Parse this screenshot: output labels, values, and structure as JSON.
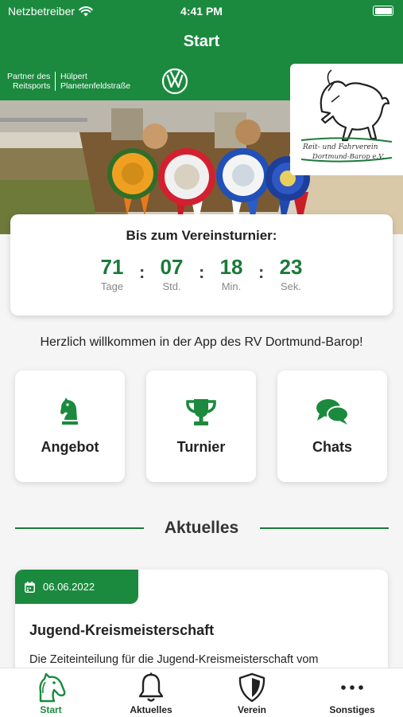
{
  "status_bar": {
    "carrier": "Netzbetreiber",
    "time": "4:41 PM"
  },
  "navbar": {
    "title": "Start"
  },
  "sponsor": {
    "partner_line1": "Partner des",
    "partner_line2": "Reitsports",
    "dealer_line1": "Hülpert",
    "dealer_line2": "Planetenfeldstraße"
  },
  "club_logo": {
    "name_line1": "Reit- und Fahrverein",
    "name_line2": "Dortmund-Barop e.V."
  },
  "countdown": {
    "heading": "Bis zum Vereinsturnier:",
    "units": [
      {
        "value": "71",
        "label": "Tage"
      },
      {
        "value": "07",
        "label": "Std."
      },
      {
        "value": "18",
        "label": "Min."
      },
      {
        "value": "23",
        "label": "Sek."
      }
    ],
    "separator": ":"
  },
  "welcome": "Herzlich willkommen in der App des RV Dortmund-Barop!",
  "tiles": [
    {
      "label": "Angebot",
      "icon": "horse-chess-knight-icon"
    },
    {
      "label": "Turnier",
      "icon": "trophy-icon"
    },
    {
      "label": "Chats",
      "icon": "chat-bubbles-icon"
    }
  ],
  "section": {
    "title": "Aktuelles"
  },
  "news": [
    {
      "date": "06.06.2022",
      "title": "Jugend-Kreismeisterschaft",
      "excerpt": "Die Zeiteinteilung für die Jugend-Kreismeisterschaft vom"
    }
  ],
  "tabbar": [
    {
      "label": "Start",
      "icon": "horse-head-icon",
      "active": true
    },
    {
      "label": "Aktuelles",
      "icon": "bell-icon",
      "active": false
    },
    {
      "label": "Verein",
      "icon": "shield-icon",
      "active": false
    },
    {
      "label": "Sonstiges",
      "icon": "more-dots-icon",
      "active": false
    }
  ],
  "colors": {
    "brand_green": "#1b8a3e",
    "text_green": "#1b7a3a",
    "background": "#f5f5f5"
  }
}
